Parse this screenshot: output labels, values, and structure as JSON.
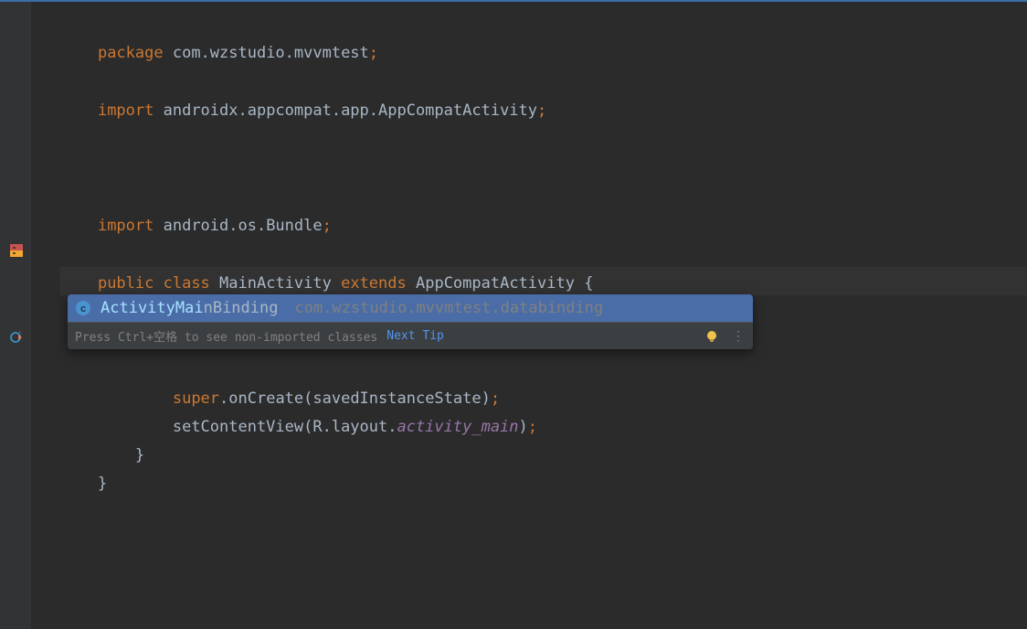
{
  "code": {
    "l1_package": "package",
    "l1_path": " com.wzstudio.mvvmtest",
    "l1_semi": ";",
    "l3_import": "import",
    "l3_path": " androidx.appcompat.app.AppCompatActivity",
    "l3_semi": ";",
    "l7_import": "import",
    "l7_path": " android.os.Bundle",
    "l7_semi": ";",
    "l9_public": "public ",
    "l9_class": "class",
    "l9_name": " MainActivity ",
    "l9_extends": "extends",
    "l9_super": " AppCompatActivity {",
    "l10_indent": "    ActivityMai",
    "l13_indent": "        ",
    "l13_super": "super",
    "l13_rest": ".onCreate(savedInstanceState)",
    "l13_semi": ";",
    "l14_indent": "        setContentView(R.layout.",
    "l14_res": "activity_main",
    "l14_close": ")",
    "l14_semi": ";",
    "l15_close": "    }",
    "l16_close": "}"
  },
  "autocomplete": {
    "match": "ActivityMai",
    "rest": "nBinding",
    "pkg": "com.wzstudio.mvvmtest.databinding",
    "hint": "Press Ctrl+空格 to see non-imported classes",
    "next_tip": "Next Tip"
  }
}
